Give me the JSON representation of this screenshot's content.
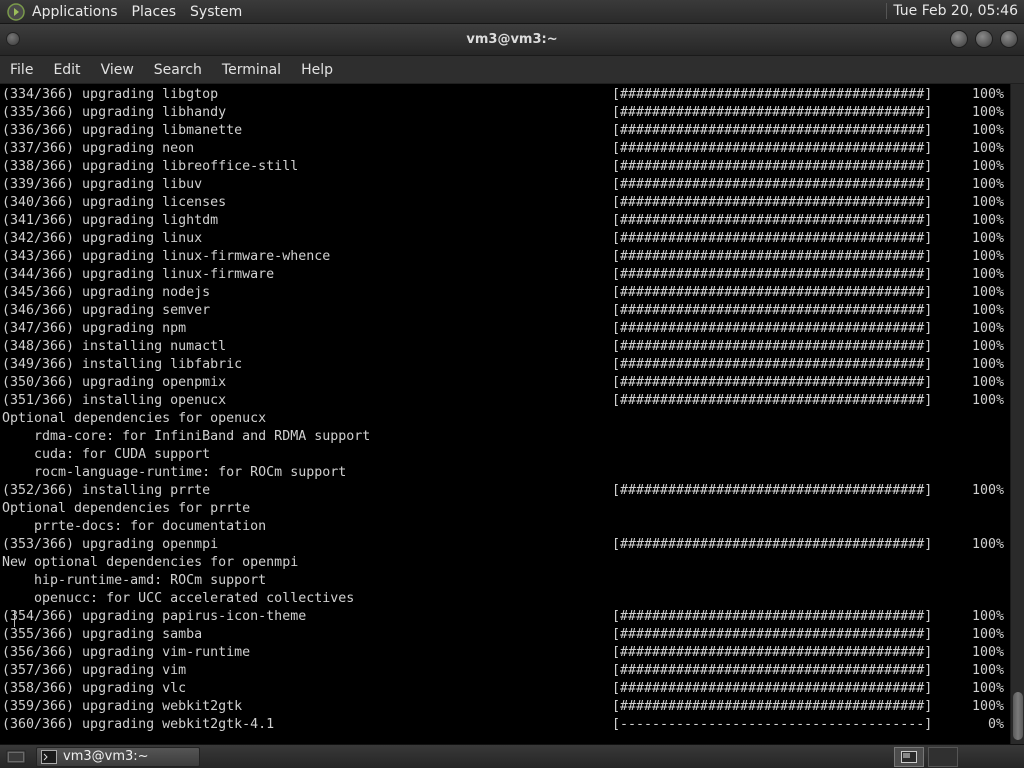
{
  "top_panel": {
    "menus": [
      "Applications",
      "Places",
      "System"
    ],
    "clock": "Tue Feb 20, 05:46"
  },
  "window": {
    "title": "vm3@vm3:~",
    "menu": [
      "File",
      "Edit",
      "View",
      "Search",
      "Terminal",
      "Help"
    ]
  },
  "terminal": {
    "lines": [
      {
        "text": "(334/366) upgrading libgtop",
        "bar": "[######################################]",
        "pct": "100%"
      },
      {
        "text": "(335/366) upgrading libhandy",
        "bar": "[######################################]",
        "pct": "100%"
      },
      {
        "text": "(336/366) upgrading libmanette",
        "bar": "[######################################]",
        "pct": "100%"
      },
      {
        "text": "(337/366) upgrading neon",
        "bar": "[######################################]",
        "pct": "100%"
      },
      {
        "text": "(338/366) upgrading libreoffice-still",
        "bar": "[######################################]",
        "pct": "100%"
      },
      {
        "text": "(339/366) upgrading libuv",
        "bar": "[######################################]",
        "pct": "100%"
      },
      {
        "text": "(340/366) upgrading licenses",
        "bar": "[######################################]",
        "pct": "100%"
      },
      {
        "text": "(341/366) upgrading lightdm",
        "bar": "[######################################]",
        "pct": "100%"
      },
      {
        "text": "(342/366) upgrading linux",
        "bar": "[######################################]",
        "pct": "100%"
      },
      {
        "text": "(343/366) upgrading linux-firmware-whence",
        "bar": "[######################################]",
        "pct": "100%"
      },
      {
        "text": "(344/366) upgrading linux-firmware",
        "bar": "[######################################]",
        "pct": "100%"
      },
      {
        "text": "(345/366) upgrading nodejs",
        "bar": "[######################################]",
        "pct": "100%"
      },
      {
        "text": "(346/366) upgrading semver",
        "bar": "[######################################]",
        "pct": "100%"
      },
      {
        "text": "(347/366) upgrading npm",
        "bar": "[######################################]",
        "pct": "100%"
      },
      {
        "text": "(348/366) installing numactl",
        "bar": "[######################################]",
        "pct": "100%"
      },
      {
        "text": "(349/366) installing libfabric",
        "bar": "[######################################]",
        "pct": "100%"
      },
      {
        "text": "(350/366) upgrading openpmix",
        "bar": "[######################################]",
        "pct": "100%"
      },
      {
        "text": "(351/366) installing openucx",
        "bar": "[######################################]",
        "pct": "100%"
      },
      {
        "text": "Optional dependencies for openucx",
        "bar": "",
        "pct": ""
      },
      {
        "text": "    rdma-core: for InfiniBand and RDMA support",
        "bar": "",
        "pct": ""
      },
      {
        "text": "    cuda: for CUDA support",
        "bar": "",
        "pct": ""
      },
      {
        "text": "    rocm-language-runtime: for ROCm support",
        "bar": "",
        "pct": ""
      },
      {
        "text": "(352/366) installing prrte",
        "bar": "[######################################]",
        "pct": "100%"
      },
      {
        "text": "Optional dependencies for prrte",
        "bar": "",
        "pct": ""
      },
      {
        "text": "    prrte-docs: for documentation",
        "bar": "",
        "pct": ""
      },
      {
        "text": "(353/366) upgrading openmpi",
        "bar": "[######################################]",
        "pct": "100%"
      },
      {
        "text": "New optional dependencies for openmpi",
        "bar": "",
        "pct": ""
      },
      {
        "text": "    hip-runtime-amd: ROCm support",
        "bar": "",
        "pct": ""
      },
      {
        "text": "    openucc: for UCC accelerated collectives",
        "bar": "",
        "pct": ""
      },
      {
        "text": "(354/366) upgrading papirus-icon-theme",
        "bar": "[######################################]",
        "pct": "100%"
      },
      {
        "text": "(355/366) upgrading samba",
        "bar": "[######################################]",
        "pct": "100%"
      },
      {
        "text": "(356/366) upgrading vim-runtime",
        "bar": "[######################################]",
        "pct": "100%"
      },
      {
        "text": "(357/366) upgrading vim",
        "bar": "[######################################]",
        "pct": "100%"
      },
      {
        "text": "(358/366) upgrading vlc",
        "bar": "[######################################]",
        "pct": "100%"
      },
      {
        "text": "(359/366) upgrading webkit2gtk",
        "bar": "[######################################]",
        "pct": "100%"
      },
      {
        "text": "(360/366) upgrading webkit2gtk-4.1",
        "bar": "[--------------------------------------]",
        "pct": "0%"
      }
    ]
  },
  "taskbar": {
    "task_label": "vm3@vm3:~"
  }
}
